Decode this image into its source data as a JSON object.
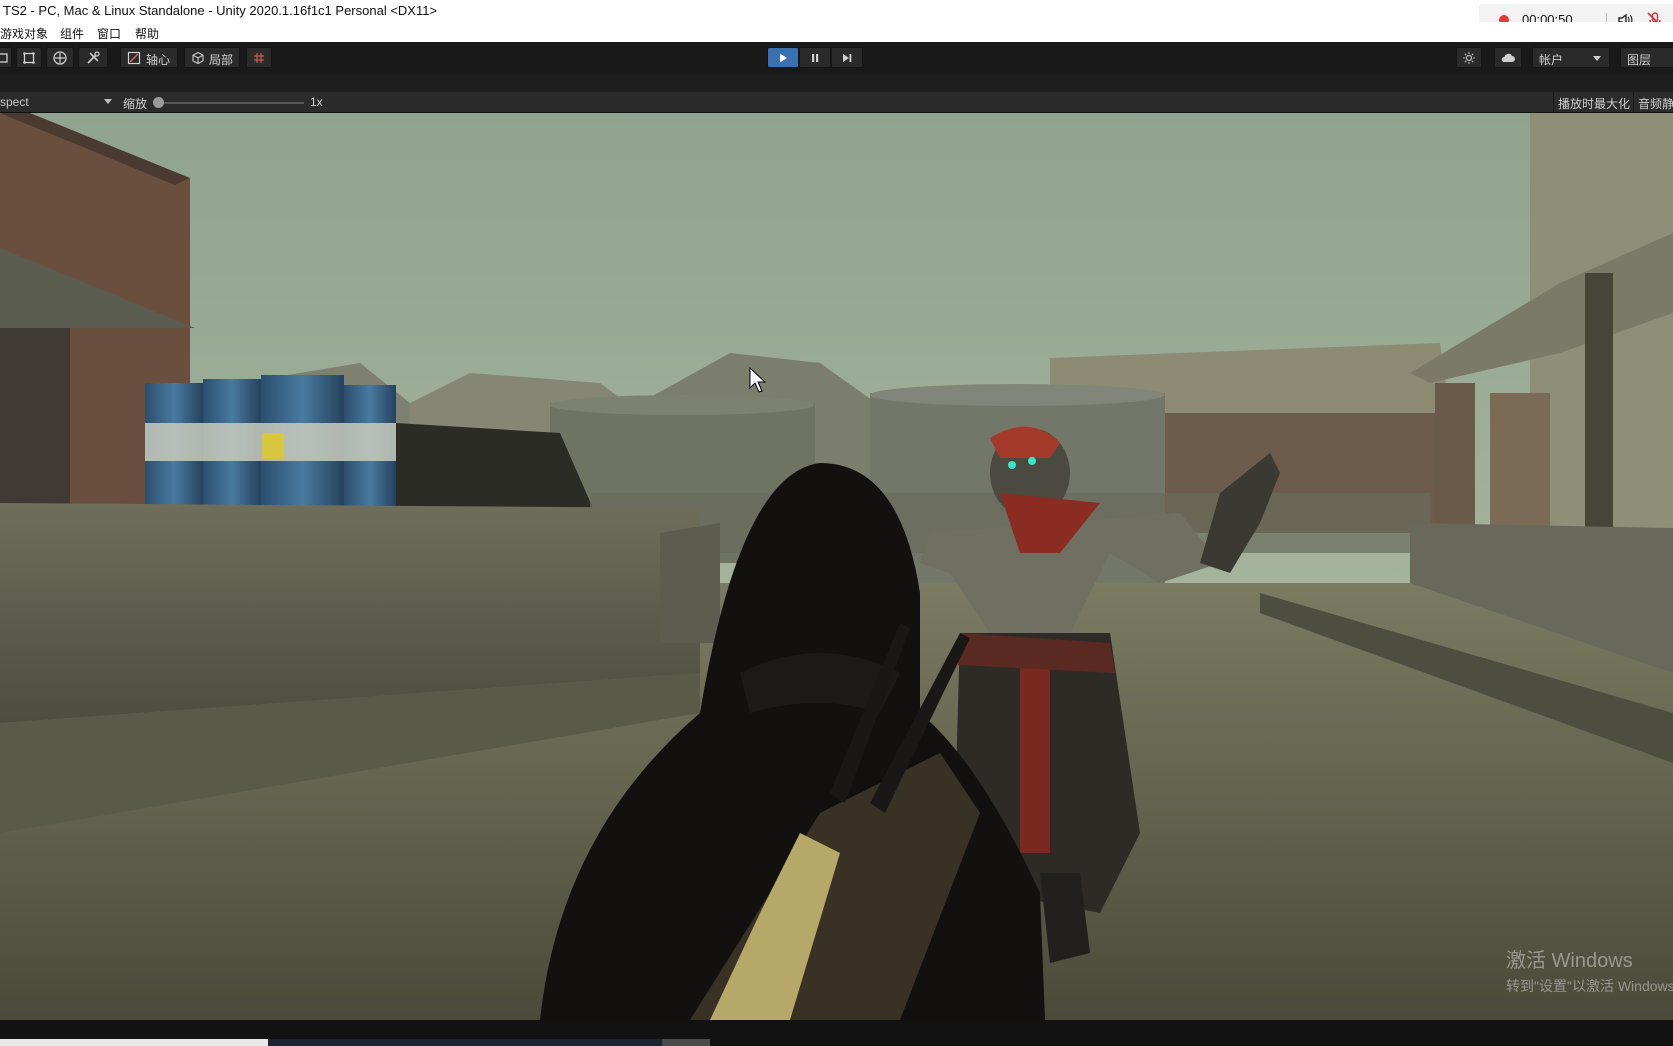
{
  "window": {
    "title": "TS2 - PC, Mac & Linux Standalone - Unity 2020.1.16f1c1 Personal <DX11>"
  },
  "recorder": {
    "time": "00:00:50",
    "icons": [
      "record-dot-icon",
      "speaker-icon",
      "mic-muted-icon"
    ]
  },
  "menu": {
    "items": [
      "游戏对象",
      "组件",
      "窗口",
      "帮助"
    ]
  },
  "toolbar": {
    "pivot_label": "轴心",
    "local_label": "局部",
    "play_state": "playing",
    "account_label": "帐户",
    "layers_label": "图层",
    "accent_color": "#3a6fb0"
  },
  "game_view": {
    "aspect_label": "spect",
    "scale_label": "缩放",
    "scale_value": "1x",
    "maximize_label": "播放时最大化",
    "mute_label": "音频静音"
  },
  "watermark": {
    "line1": "激活 Windows",
    "line2": "转到\"设置\"以激活 Windows。"
  }
}
